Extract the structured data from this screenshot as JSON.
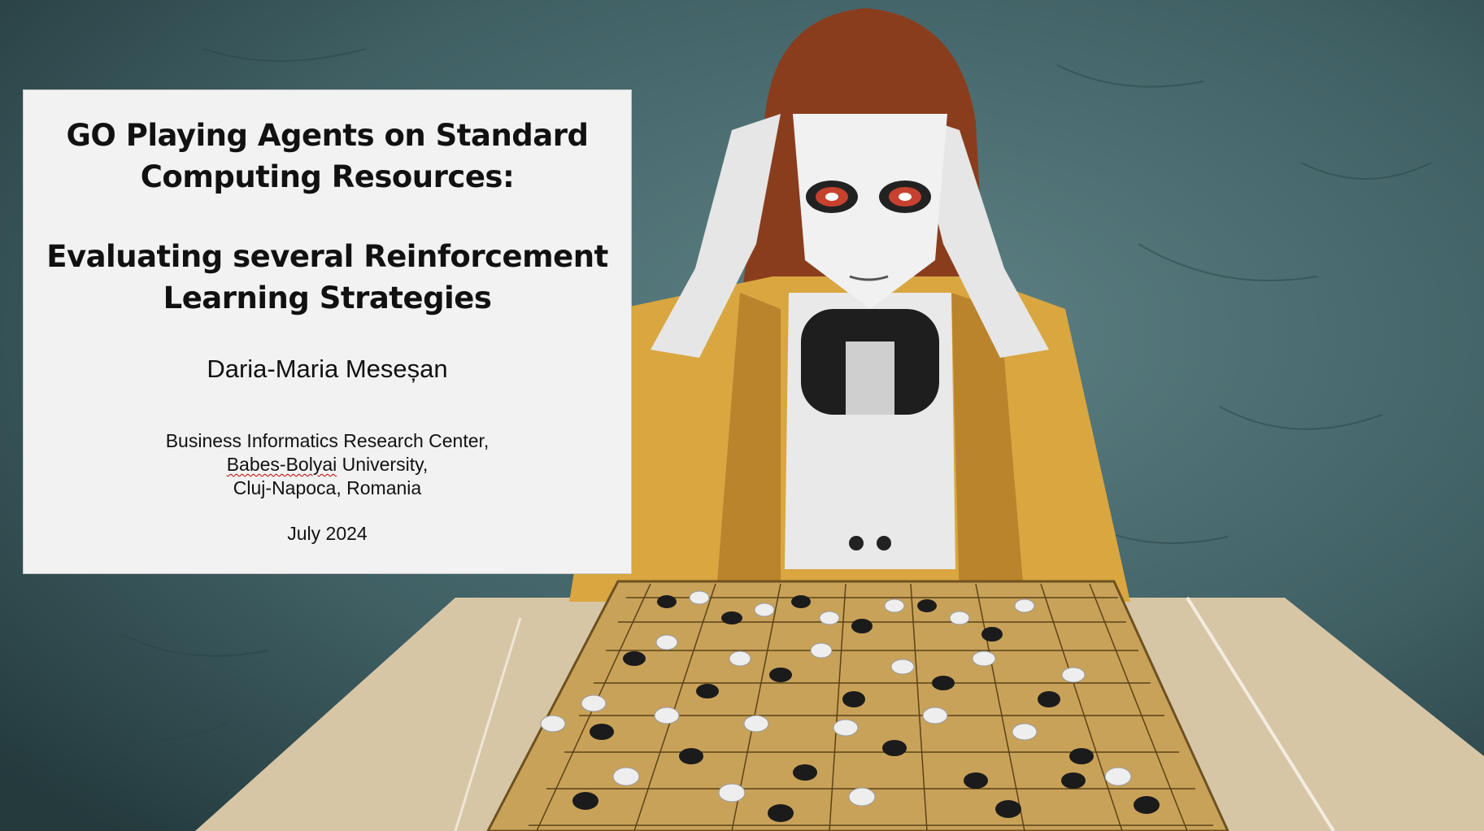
{
  "slide": {
    "title_line1": "GO Playing Agents on Standard",
    "title_line2": "Computing Resources:",
    "title_line3": "Evaluating several Reinforcement",
    "title_line4": "Learning Strategies",
    "author": "Daria-Maria Meseșan",
    "affiliation": {
      "line1": "Business Informatics Research Center,",
      "line2_word1": "Babes-Bolyai",
      "line2_rest": " University,",
      "line3": "Cluj-Napoca, Romania"
    },
    "date": "July 2024"
  },
  "background": {
    "illustration": "robot-playing-go-illustration",
    "colors": {
      "wall": "#3e5c60",
      "board": "#c9a25a",
      "robot_jacket": "#d9a640",
      "hair": "#8a3d1d"
    }
  }
}
